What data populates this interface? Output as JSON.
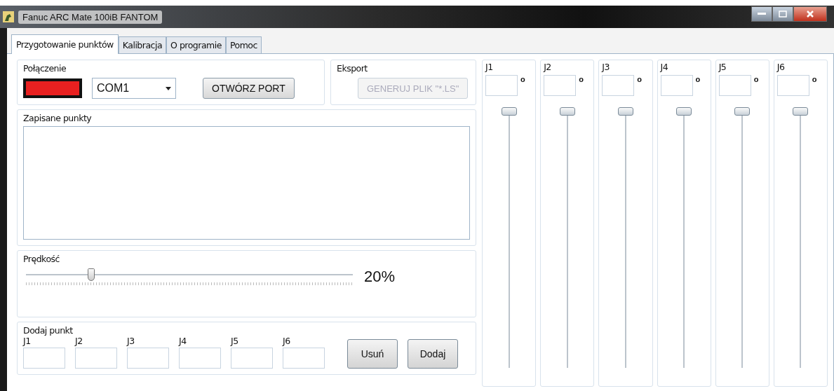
{
  "window": {
    "title": "Fanuc ARC Mate 100iB FANTOM"
  },
  "tabs": [
    {
      "label": "Przygotowanie punktów",
      "selected": true
    },
    {
      "label": "Kalibracja",
      "selected": false
    },
    {
      "label": "O programie",
      "selected": false
    },
    {
      "label": "Pomoc",
      "selected": false
    }
  ],
  "connection": {
    "title": "Połączenie",
    "connected": false,
    "port": "COM1",
    "open_button": "OTWÓRZ PORT"
  },
  "export": {
    "title": "Eksport",
    "button": "GENERUJ PLIK \"*.LS\"",
    "disabled": true
  },
  "saved_points": {
    "title": "Zapisane punkty"
  },
  "speed": {
    "title": "Prędkość",
    "level": 0.2,
    "reading": "20%"
  },
  "add_point": {
    "title": "Dodaj punkt",
    "fields": [
      {
        "label": "J1"
      },
      {
        "label": "J2"
      },
      {
        "label": "J3"
      },
      {
        "label": "J4"
      },
      {
        "label": "J5"
      },
      {
        "label": "J6"
      }
    ],
    "buttons": [
      "Usuń",
      "Dodaj"
    ]
  },
  "joints": [
    {
      "label": "J1",
      "unit": "o",
      "level": 1
    },
    {
      "label": "J2",
      "unit": "o",
      "level": 1
    },
    {
      "label": "J3",
      "unit": "o",
      "level": 1
    },
    {
      "label": "J4",
      "unit": "o",
      "level": 1
    },
    {
      "label": "J5",
      "unit": "o",
      "level": 1
    },
    {
      "label": "J6",
      "unit": "o",
      "level": 1
    }
  ]
}
